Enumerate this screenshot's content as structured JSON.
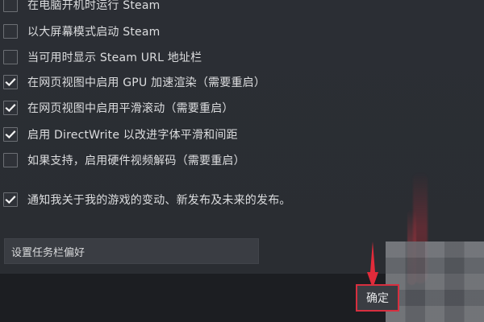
{
  "settings": {
    "items": [
      {
        "label": "在电脑开机时运行 Steam",
        "checked": false
      },
      {
        "label": "以大屏幕模式启动 Steam",
        "checked": false
      },
      {
        "label": "当可用时显示 Steam URL 地址栏",
        "checked": false
      },
      {
        "label": "在网页视图中启用 GPU 加速渲染（需要重启）",
        "checked": true
      },
      {
        "label": "在网页视图中启用平滑滚动（需要重启）",
        "checked": true
      },
      {
        "label": "启用 DirectWrite 以改进字体平滑和间距",
        "checked": true
      },
      {
        "label": "如果支持，启用硬件视频解码（需要重启）",
        "checked": false
      },
      {
        "label": "通知我关于我的游戏的变动、新发布及未来的发布。",
        "checked": true
      }
    ],
    "taskbar_preferences_label": "设置任务栏偏好"
  },
  "footer": {
    "ok_label": "确定"
  },
  "icons": {
    "checkmark": "checkmark-icon",
    "annotation_arrow": "red-arrow-icon"
  },
  "colors": {
    "accent_red": "#d72f3f"
  }
}
